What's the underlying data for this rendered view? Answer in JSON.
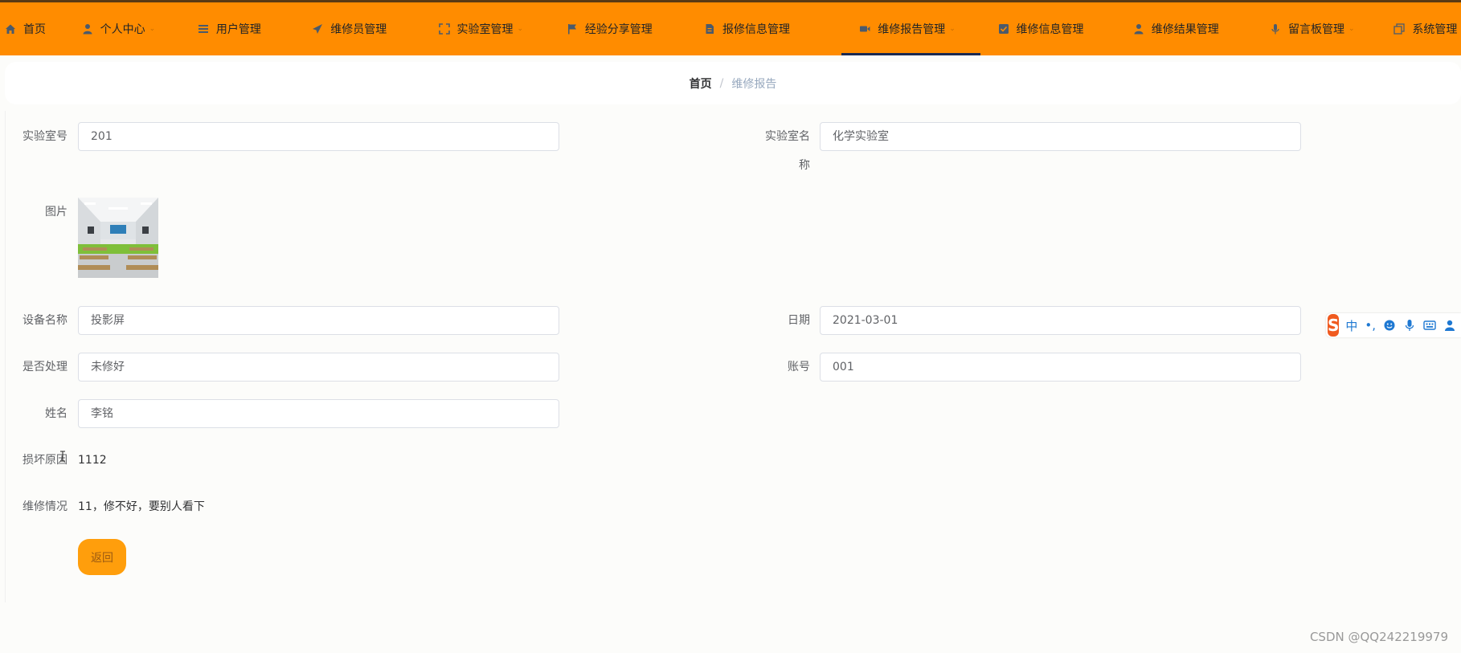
{
  "nav": {
    "items": [
      {
        "label": "首页",
        "icon": "home-icon",
        "dropdown": false
      },
      {
        "label": "个人中心",
        "icon": "user-icon",
        "dropdown": true
      },
      {
        "label": "用户管理",
        "icon": "list-icon",
        "dropdown": false
      },
      {
        "label": "维修员管理",
        "icon": "paper-plane-icon",
        "dropdown": false
      },
      {
        "label": "实验室管理",
        "icon": "expand-icon",
        "dropdown": true
      },
      {
        "label": "经验分享管理",
        "icon": "flag-icon",
        "dropdown": false
      },
      {
        "label": "报修信息管理",
        "icon": "document-icon",
        "dropdown": false
      },
      {
        "label": "维修报告管理",
        "icon": "video-icon",
        "dropdown": true
      },
      {
        "label": "维修信息管理",
        "icon": "checkbox-icon",
        "dropdown": false
      },
      {
        "label": "维修结果管理",
        "icon": "person-icon",
        "dropdown": false
      },
      {
        "label": "留言板管理",
        "icon": "microphone-icon",
        "dropdown": true
      },
      {
        "label": "系统管理",
        "icon": "copy-icon",
        "dropdown": false
      }
    ],
    "active_index": 7,
    "accent": "#ff8c00",
    "active_underline": "#1b2a52"
  },
  "breadcrumb": {
    "home": "首页",
    "separator": "/",
    "current": "维修报告"
  },
  "form": {
    "lab_no_label": "实验室号",
    "lab_no_value": "201",
    "lab_name_label_line1": "实验室名",
    "lab_name_label_line2": "称",
    "lab_name_value": "化学实验室",
    "image_label": "图片",
    "device_label": "设备名称",
    "device_value": "投影屏",
    "date_label": "日期",
    "date_value": "2021-03-01",
    "handled_label": "是否处理",
    "handled_value": "未修好",
    "account_label": "账号",
    "account_value": "001",
    "name_label": "姓名",
    "name_value": "李铭",
    "cause_label": "损坏原因",
    "cause_value": "1112",
    "repair_label": "维修情况",
    "repair_value": "11，修不好，要别人看下",
    "back_button": "返回"
  },
  "ime": {
    "logo": "S",
    "mode": "中",
    "punct": "•,"
  },
  "watermark": "CSDN @QQ242219979"
}
